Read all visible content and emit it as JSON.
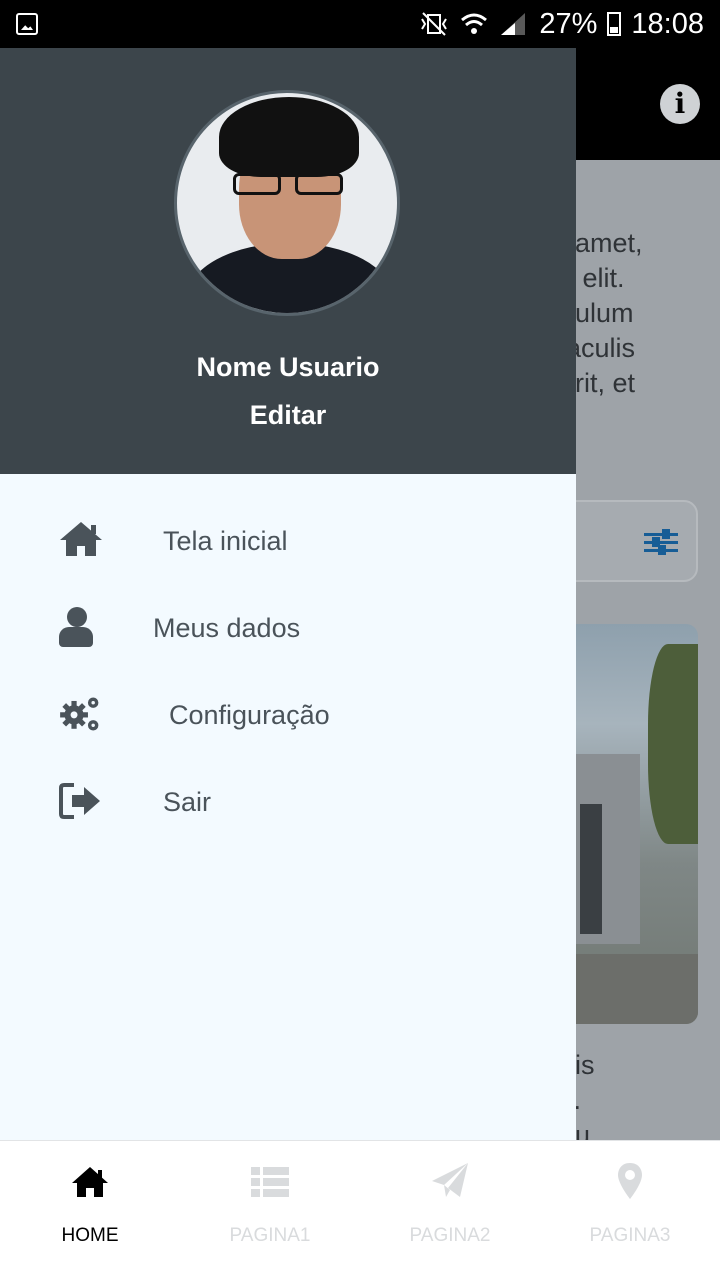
{
  "status_bar": {
    "battery": "27%",
    "time": "18:08"
  },
  "background": {
    "text_top": "t amet,\ng elit.\nbulum\niaculis\nerit, et",
    "text_bottom": "dis\ns.\neu"
  },
  "drawer": {
    "user_name": "Nome Usuario",
    "edit_label": "Editar",
    "items": [
      {
        "label": "Tela inicial",
        "icon": "home-icon"
      },
      {
        "label": "Meus dados",
        "icon": "user-icon"
      },
      {
        "label": "Configuração",
        "icon": "gears-icon"
      },
      {
        "label": "Sair",
        "icon": "sign-out-icon"
      }
    ]
  },
  "bottom_nav": {
    "tabs": [
      {
        "label": "HOME",
        "icon": "home-icon",
        "active": true
      },
      {
        "label": "PAGINA1",
        "icon": "list-icon",
        "active": false
      },
      {
        "label": "PAGINA2",
        "icon": "paper-plane-icon",
        "active": false
      },
      {
        "label": "PAGINA3",
        "icon": "map-marker-icon",
        "active": false
      }
    ]
  },
  "colors": {
    "drawer_header": "#3c454b",
    "drawer_bg": "#f3faff",
    "menu_text": "#4a535a",
    "accent_icon": "#175d96",
    "tab_active": "#000000",
    "tab_inactive": "#d9dbdd"
  }
}
